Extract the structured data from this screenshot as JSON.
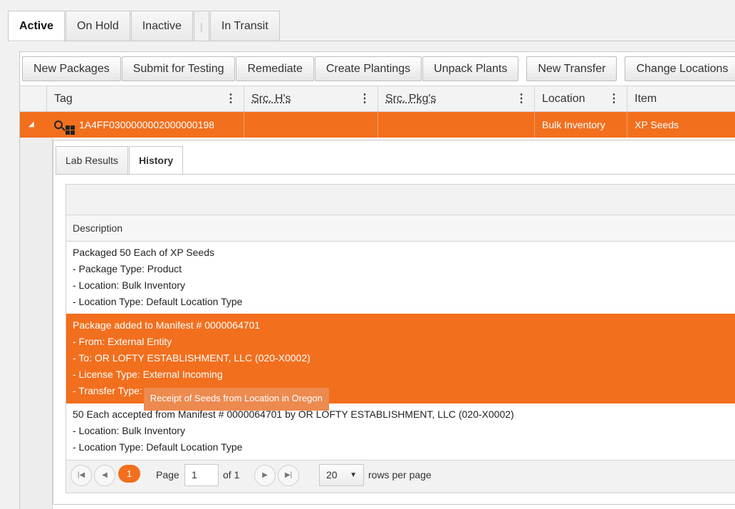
{
  "status_tabs": [
    "Active",
    "On Hold",
    "Inactive",
    "|",
    "In Transit"
  ],
  "toolbar": {
    "buttons": [
      "New Packages",
      "Submit for Testing",
      "Remediate",
      "Create Plantings",
      "Unpack Plants"
    ],
    "buttons2": [
      "New Transfer",
      "Change Locations"
    ]
  },
  "grid": {
    "columns": [
      "Tag",
      "Src. H's",
      "Src. Pkg's",
      "Location",
      "Item"
    ],
    "menu_glyph": "⋮",
    "row": {
      "tag": "1A4FF0300000002000000198",
      "src_h": "",
      "src_pkg": "",
      "location": "Bulk Inventory",
      "item": "XP Seeds"
    }
  },
  "detail": {
    "tabs": [
      "Lab Results",
      "History"
    ],
    "header": "Description",
    "rows": [
      [
        "Packaged 50 Each of XP Seeds",
        "- Package Type: Product",
        "- Location: Bulk Inventory",
        "- Location Type: Default Location Type"
      ],
      [
        "Package added to Manifest # 0000064701",
        "- From: External Entity",
        "- To: OR LOFTY ESTABLISHMENT, LLC (020-X0002)",
        "- License Type: External Incoming",
        "- Transfer Type:"
      ],
      [
        "50 Each accepted from Manifest # 0000064701 by OR LOFTY ESTABLISHMENT, LLC (020-X0002)",
        "- Location: Bulk Inventory",
        "- Location Type: Default Location Type"
      ]
    ],
    "tooltip": "Receipt of Seeds from Location in Oregon"
  },
  "pager": {
    "current": "1",
    "page_label": "Page",
    "page_value": "1",
    "of_label": "of 1",
    "page_size": "20",
    "rows_label": "rows per page"
  }
}
